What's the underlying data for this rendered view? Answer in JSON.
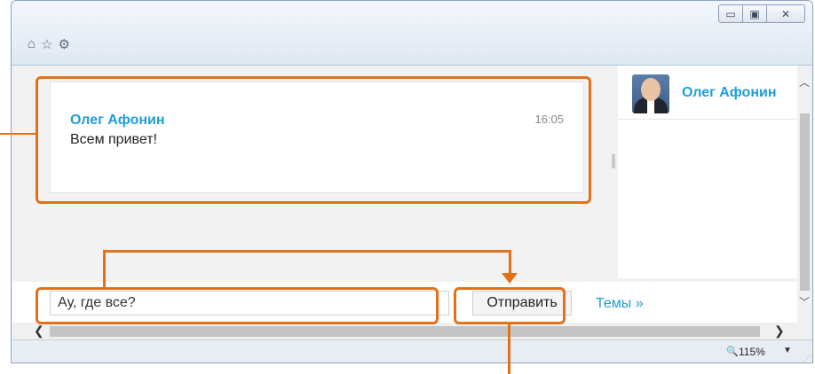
{
  "window": {
    "controls": {
      "minimize": "▭",
      "maximize": "▣",
      "close": "✕"
    },
    "toolbar_icons": [
      "home-icon",
      "star-icon",
      "gear-icon"
    ]
  },
  "chat": {
    "message": {
      "author": "Олег Афонин",
      "time": "16:05",
      "text": "Всем привет!"
    }
  },
  "users": [
    {
      "name": "Олег Афонин",
      "avatar": "user-avatar"
    }
  ],
  "composer": {
    "input_value": "Ау, где все?",
    "send_label": "Отправить",
    "topics_link": "Темы »"
  },
  "statusbar": {
    "zoom": "115%"
  },
  "colors": {
    "accent": "#1e9ed8",
    "highlight": "#e2711b"
  }
}
